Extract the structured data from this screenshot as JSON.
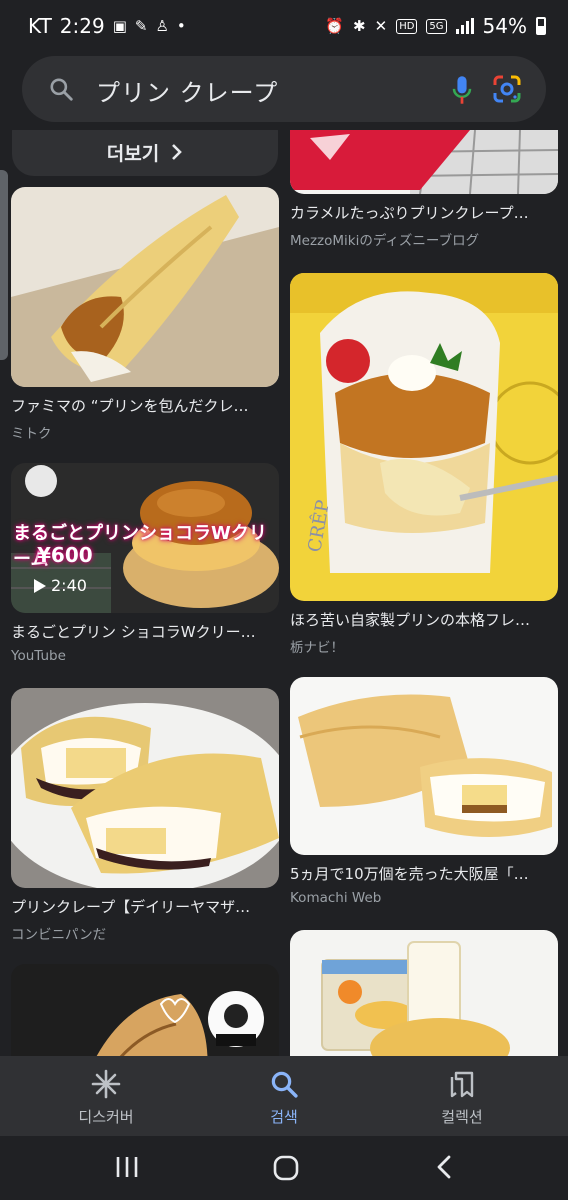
{
  "status_bar": {
    "carrier": "KT",
    "time": "2:29",
    "net_badge_hd": "HD",
    "net_badge_5g": "5G",
    "battery": "54%"
  },
  "search": {
    "query": "プリン クレープ"
  },
  "more_button": {
    "label": "더보기"
  },
  "results": [
    {
      "caption": "カラメルたっぷりプリンクレープ…",
      "source": "MezzoMikiのディズニーブログ"
    },
    {
      "caption": "ファミマの “プリンを包んだクレ…",
      "source": "ミトク"
    },
    {
      "caption": "ほろ苦い自家製プリンの本格フレ…",
      "source": "栃ナビ！"
    },
    {
      "caption": "まるごとプリン ショコラWクリー…",
      "source": "YouTube",
      "duration": "2:40",
      "overlay_title": "まるごとプリンショコラWクリーム",
      "overlay_price": "¥600"
    },
    {
      "caption": "5ヵ月で10万個を売った大阪屋「…",
      "source": "Komachi Web"
    },
    {
      "caption": "プリンクレープ【デイリーヤマザ…",
      "source": "コンビニパンだ"
    }
  ],
  "bottom_nav": {
    "discover": "디스커버",
    "search": "검색",
    "collections": "컬렉션"
  },
  "colors": {
    "accent": "#8ab4f8",
    "background": "#202124",
    "surface": "#303134"
  }
}
